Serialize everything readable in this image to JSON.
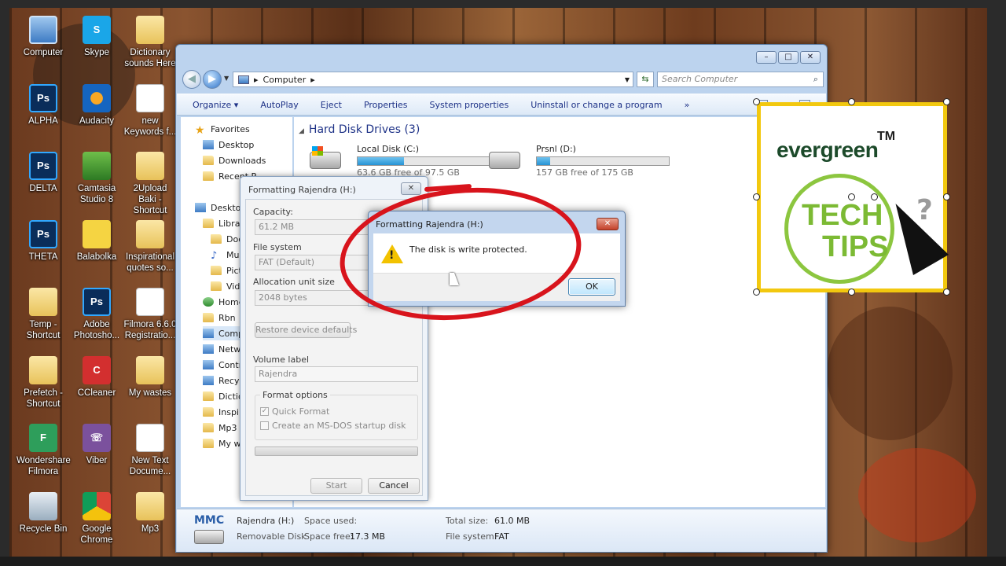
{
  "desktop": {
    "icons": [
      {
        "label": "Computer",
        "glyph": "computer-icon"
      },
      {
        "label": "Skype",
        "glyph": "skype-icon"
      },
      {
        "label": "Dictionary sounds Here",
        "glyph": "folder-icon"
      },
      {
        "label": "ALPHA",
        "glyph": "photoshop-file-icon"
      },
      {
        "label": "Audacity",
        "glyph": "audacity-icon"
      },
      {
        "label": "new Keywords f...",
        "glyph": "document-icon"
      },
      {
        "label": "DELTA",
        "glyph": "photoshop-file-icon"
      },
      {
        "label": "Camtasia Studio 8",
        "glyph": "camtasia-icon"
      },
      {
        "label": "2Upload Baki - Shortcut",
        "glyph": "folder-icon"
      },
      {
        "label": "THETA",
        "glyph": "photoshop-file-icon"
      },
      {
        "label": "Balabolka",
        "glyph": "balabolka-icon"
      },
      {
        "label": "Inspirational quotes so...",
        "glyph": "folder-icon"
      },
      {
        "label": "Temp - Shortcut",
        "glyph": "folder-icon"
      },
      {
        "label": "Adobe Photosho...",
        "glyph": "photoshop-icon"
      },
      {
        "label": "Filmora 6.6.0 Registratio...",
        "glyph": "document-icon"
      },
      {
        "label": "Prefetch - Shortcut",
        "glyph": "folder-icon"
      },
      {
        "label": "CCleaner",
        "glyph": "ccleaner-icon"
      },
      {
        "label": "My wastes",
        "glyph": "folder-icon"
      },
      {
        "label": "Wondershare Filmora",
        "glyph": "filmora-icon"
      },
      {
        "label": "Viber",
        "glyph": "viber-icon"
      },
      {
        "label": "New Text Docume...",
        "glyph": "document-icon"
      },
      {
        "label": "Recycle Bin",
        "glyph": "recycle-bin-icon"
      },
      {
        "label": "Google Chrome",
        "glyph": "chrome-icon"
      },
      {
        "label": "Mp3",
        "glyph": "folder-icon"
      }
    ]
  },
  "explorer": {
    "address": "Computer",
    "search_placeholder": "Search Computer",
    "window_controls": {
      "minimize": "–",
      "maximize": "□",
      "close": "✕"
    },
    "toolbar": {
      "organize": "Organize ▾",
      "autoplay": "AutoPlay",
      "eject": "Eject",
      "properties": "Properties",
      "system_properties": "System properties",
      "uninstall": "Uninstall or change a program",
      "more": "»"
    },
    "nav": {
      "favorites": "Favorites",
      "desktop": "Desktop",
      "downloads": "Downloads",
      "recent": "Recent P",
      "desktop2": "Desktop",
      "libraries": "Librari",
      "documents": "Doc",
      "music": "Mus",
      "pictures": "Pictu",
      "videos": "Vide",
      "homegroup": "Home",
      "rbn": "Rbn",
      "computer": "Comp",
      "network": "Netwo",
      "control": "Contro",
      "recycle": "Recyc",
      "diction": "Dictio",
      "inspira": "Inspira",
      "mp3": "Mp3",
      "mywastes": "My wa"
    },
    "hard_disk_header": "Hard Disk Drives (3)",
    "drives": [
      {
        "name": "Local Disk (C:)",
        "free": "63.6 GB free of 97.5 GB",
        "used_fraction": 0.35
      },
      {
        "name": "Prsnl (D:)",
        "free": "157 GB free of 175 GB",
        "used_fraction": 0.1
      }
    ],
    "details": {
      "title": "MMC",
      "name": "Rajendra (H:)",
      "type": "Removable Disk",
      "space_used_label": "Space used:",
      "space_free_label": "Space free:",
      "space_free": "17.3 MB",
      "total_label": "Total size:",
      "total": "61.0 MB",
      "fs_label": "File system:",
      "fs": "FAT"
    }
  },
  "format_dialog": {
    "title": "Formatting Rajendra (H:)",
    "close": "✕",
    "capacity_label": "Capacity:",
    "capacity": "61.2 MB",
    "fs_label": "File system",
    "fs": "FAT (Default)",
    "alloc_label": "Allocation unit size",
    "alloc": "2048 bytes",
    "restore": "Restore device defaults",
    "volume_label": "Volume label",
    "volume": "Rajendra",
    "options_title": "Format options",
    "quick": "Quick Format",
    "msdos": "Create an MS-DOS startup disk",
    "start": "Start",
    "cancel": "Cancel"
  },
  "message_box": {
    "title": "Formatting Rajendra (H:)",
    "close": "✕",
    "text": "The disk is write protected.",
    "ok": "OK"
  },
  "logo": {
    "brand": "evergreen",
    "tm": "TM",
    "tech": "TECH",
    "tips": "TIPS",
    "qmark": "?"
  }
}
